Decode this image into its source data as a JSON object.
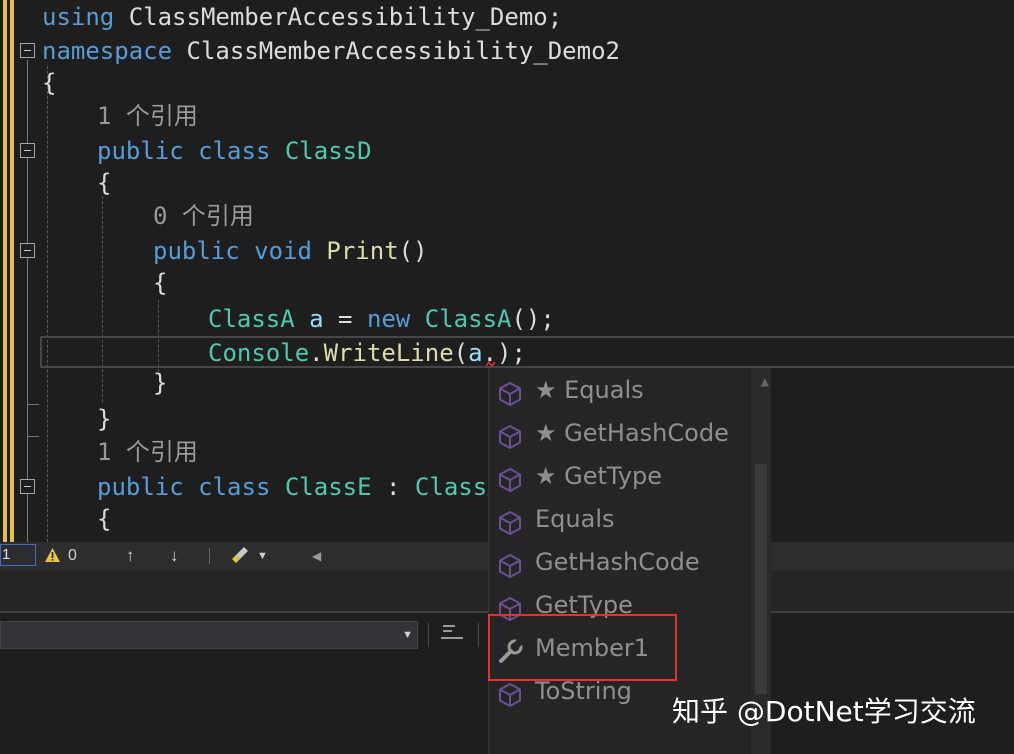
{
  "code_lines": [
    {
      "line_id": "using",
      "tokens": [
        {
          "t": "using",
          "c": "kw"
        },
        {
          "t": " ClassMemberAccessibility_Demo;",
          "c": "pl"
        }
      ]
    },
    {
      "line_id": "namespace",
      "tokens": [
        {
          "t": "namespace",
          "c": "kw"
        },
        {
          "t": " ClassMemberAccessibility_Demo2",
          "c": "pl"
        }
      ]
    },
    {
      "line_id": "ns-open-brace",
      "tokens": [
        {
          "t": "{",
          "c": "pl"
        }
      ]
    },
    {
      "line_id": "classd-decl",
      "tokens": [
        {
          "t": "public",
          "c": "kw"
        },
        {
          "t": " ",
          "c": "pl"
        },
        {
          "t": "class",
          "c": "kw"
        },
        {
          "t": " ",
          "c": "pl"
        },
        {
          "t": "ClassD",
          "c": "ty"
        }
      ]
    },
    {
      "line_id": "classd-open-brace",
      "tokens": [
        {
          "t": "{",
          "c": "pl"
        }
      ]
    },
    {
      "line_id": "print-decl",
      "tokens": [
        {
          "t": "public",
          "c": "kw"
        },
        {
          "t": " ",
          "c": "pl"
        },
        {
          "t": "void",
          "c": "kw"
        },
        {
          "t": " ",
          "c": "pl"
        },
        {
          "t": "Print",
          "c": "fn"
        },
        {
          "t": "()",
          "c": "pl"
        }
      ]
    },
    {
      "line_id": "print-open-brace",
      "tokens": [
        {
          "t": "{",
          "c": "pl"
        }
      ]
    },
    {
      "line_id": "classa-new",
      "tokens": [
        {
          "t": "ClassA",
          "c": "ty"
        },
        {
          "t": " ",
          "c": "pl"
        },
        {
          "t": "a",
          "c": "id"
        },
        {
          "t": " = ",
          "c": "pl"
        },
        {
          "t": "new",
          "c": "kw"
        },
        {
          "t": " ",
          "c": "pl"
        },
        {
          "t": "ClassA",
          "c": "ty"
        },
        {
          "t": "();",
          "c": "pl"
        }
      ]
    },
    {
      "line_id": "writeline",
      "tokens": [
        {
          "t": "Console",
          "c": "ty"
        },
        {
          "t": ".",
          "c": "pl"
        },
        {
          "t": "WriteLine",
          "c": "fn"
        },
        {
          "t": "(",
          "c": "pl"
        },
        {
          "t": "a",
          "c": "id"
        },
        {
          "t": ".",
          "c": "pl"
        },
        {
          "t": ");",
          "c": "pl"
        }
      ]
    },
    {
      "line_id": "print-close-brace",
      "tokens": [
        {
          "t": "}",
          "c": "pl"
        }
      ]
    },
    {
      "line_id": "classd-close-brace",
      "tokens": [
        {
          "t": "}",
          "c": "pl"
        }
      ]
    },
    {
      "line_id": "classe-decl",
      "tokens": [
        {
          "t": "public",
          "c": "kw"
        },
        {
          "t": " ",
          "c": "pl"
        },
        {
          "t": "class",
          "c": "kw"
        },
        {
          "t": " ",
          "c": "pl"
        },
        {
          "t": "ClassE",
          "c": "ty"
        },
        {
          "t": " : ",
          "c": "pl"
        },
        {
          "t": "ClassA",
          "c": "ty"
        }
      ]
    },
    {
      "line_id": "classe-open-brace",
      "tokens": [
        {
          "t": "{",
          "c": "pl"
        }
      ]
    }
  ],
  "code_lens": {
    "classd": "1 个引用",
    "print": "0 个引用",
    "classe": "1 个引用"
  },
  "status_bar": {
    "zoom_fragment": "1",
    "warning_count": "0",
    "up_arrow": "↑",
    "down_arrow": "↓"
  },
  "completion_list": [
    {
      "label": "★ Equals",
      "icon": "method-cube-icon"
    },
    {
      "label": "★ GetHashCode",
      "icon": "method-cube-icon"
    },
    {
      "label": "★ GetType",
      "icon": "method-cube-icon"
    },
    {
      "label": "Equals",
      "icon": "method-cube-icon"
    },
    {
      "label": "GetHashCode",
      "icon": "method-cube-icon"
    },
    {
      "label": "GetType",
      "icon": "method-cube-icon"
    },
    {
      "label": "Member1",
      "icon": "wrench-icon"
    },
    {
      "label": "ToString",
      "icon": "method-cube-icon"
    }
  ],
  "panel_toolbar": {
    "word_wrap_glyph": "abc"
  },
  "watermark": "知乎 @DotNet学习交流",
  "colors": {
    "editor_bg": "#1e1e1e",
    "keyword": "#569cd6",
    "type": "#4ec9b0",
    "method": "#dcdcaa",
    "identifier": "#9cdcfe",
    "annotation_red": "#e5322d",
    "gutter_yellow": "#e0c24a"
  }
}
